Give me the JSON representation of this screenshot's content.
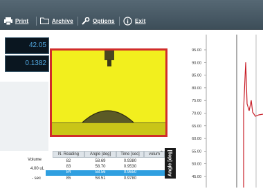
{
  "toolbar": {
    "print_label": "Print",
    "archive_label": "Archive",
    "options_label": "Options",
    "exit_label": "Exit"
  },
  "readouts": {
    "top_value": "42.05",
    "bottom_value": "0.1382"
  },
  "chart": {
    "y_ticks": [
      "95.00",
      "90.00",
      "85.00",
      "80.00",
      "75.00",
      "70.00",
      "65.00",
      "60.00",
      "55.00",
      "50.00",
      "45.00"
    ],
    "ylabel": "Angle [deg]",
    "line_color": "#c81e28"
  },
  "table": {
    "headers": [
      "N. Reading",
      "Angle [deg]",
      "Time [sec]",
      "volum"
    ],
    "rows": [
      {
        "n": "82",
        "angle": "58.69",
        "time": "0.9380"
      },
      {
        "n": "83",
        "angle": "58.70",
        "time": "0.9530"
      },
      {
        "n": "84",
        "angle": "58.56",
        "time": "0.9650"
      },
      {
        "n": "85",
        "angle": "58.51",
        "time": "0.9780"
      }
    ],
    "selected_row": 2
  },
  "side": {
    "volume_label": "Volume",
    "volume_value": "4.00 uL",
    "minus_sec": "- sec"
  }
}
